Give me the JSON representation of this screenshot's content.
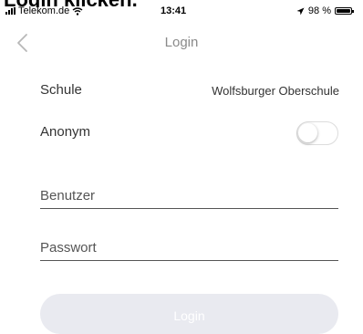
{
  "caption": "Login klicken.",
  "status_bar": {
    "carrier": "Telekom.de",
    "time": "13:41",
    "battery": "98 %",
    "battery_level": 0.98
  },
  "nav": {
    "title": "Login",
    "back_icon": "chevron-left-icon"
  },
  "form": {
    "school_label": "Schule",
    "school_value": "Wolfsburger Oberschule",
    "anonymous_label": "Anonym",
    "anonymous_enabled": false,
    "username_placeholder": "Benutzer",
    "password_placeholder": "Passwort",
    "login_label": "Login"
  },
  "colors": {
    "button_background": "#e9eaf0",
    "title_gray": "#8a8a8a"
  }
}
